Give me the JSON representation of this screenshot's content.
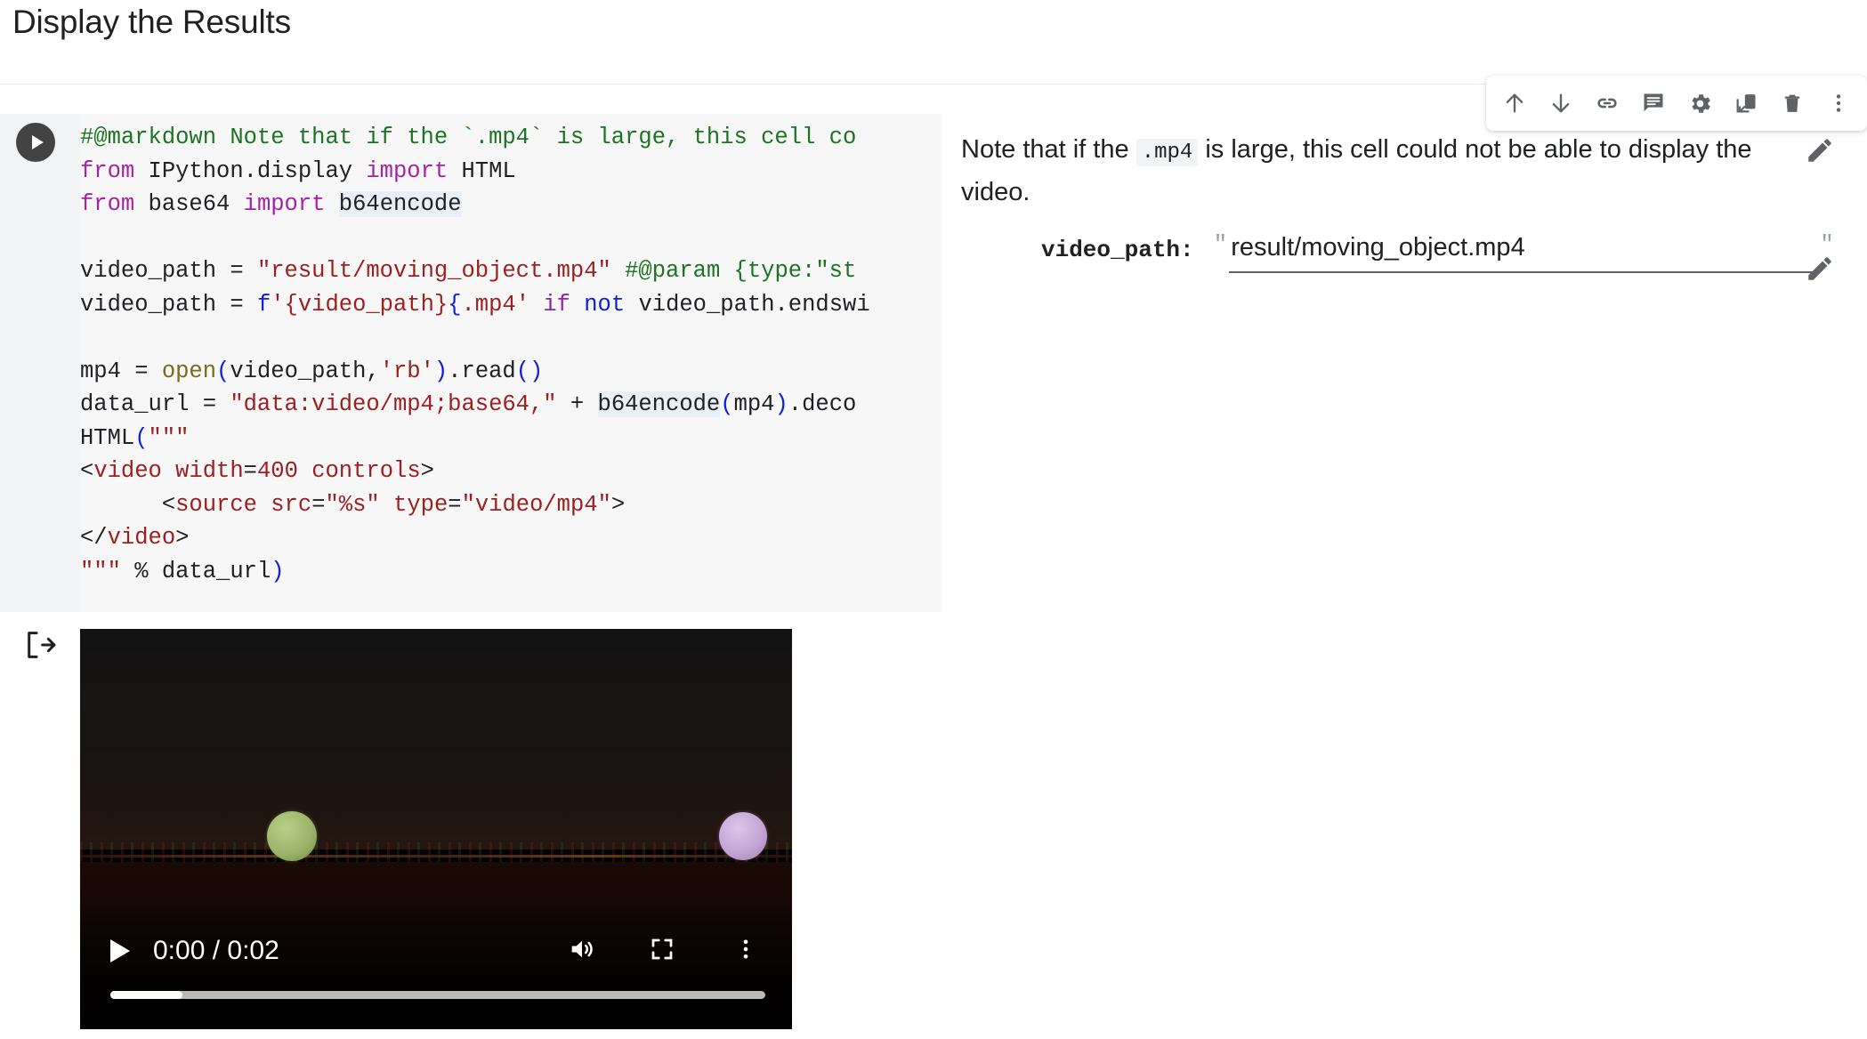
{
  "heading": "Display the Results",
  "toolbar": {
    "buttons": [
      {
        "name": "move-cell-up",
        "icon": "arrow-up-icon"
      },
      {
        "name": "move-cell-down",
        "icon": "arrow-down-icon"
      },
      {
        "name": "copy-link-to-cell",
        "icon": "link-icon"
      },
      {
        "name": "add-comment",
        "icon": "comment-icon"
      },
      {
        "name": "cell-settings",
        "icon": "gear-icon"
      },
      {
        "name": "mirror-cell-in-tab",
        "icon": "open-in-new-icon"
      },
      {
        "name": "delete-cell",
        "icon": "trash-icon"
      },
      {
        "name": "more-cell-actions",
        "icon": "more-vert-icon"
      }
    ]
  },
  "cell": {
    "run_button_label": "Run cell",
    "code_lines": [
      "#@markdown Note that if the `.mp4` is large, this cell co",
      "from IPython.display import HTML",
      "from base64 import b64encode",
      "",
      "video_path = \"result/moving_object.mp4\" #@param {type:\"st",
      "video_path = f'{video_path}.mp4' if not video_path.endswi",
      "",
      "mp4 = open(video_path,'rb').read()",
      "data_url = \"data:video/mp4;base64,\" + b64encode(mp4).deco",
      "HTML(\"\"\"",
      "<video width=400 controls>",
      "      <source src=\"%s\" type=\"video/mp4\">",
      "</video>",
      "\"\"\" % data_url)"
    ]
  },
  "form": {
    "note_part1": "Note that if the",
    "note_code": ".mp4",
    "note_part2": "is large, this cell could not be able to display the video.",
    "field_label": "video_path:",
    "field_value": "result/moving_object.mp4",
    "field_placeholder": "result/moving_object.mp4",
    "quote_open": "\"",
    "quote_close": "\"",
    "edit_note_icon": "pencil-icon",
    "edit_field_icon": "pencil-icon"
  },
  "output": {
    "icon": "output-arrow-icon",
    "video": {
      "play_label": "play",
      "time_display": "0:00 / 0:02",
      "current_time": "0:00",
      "duration": "0:02",
      "progress_percent": 11,
      "volume_icon": "volume-up-icon",
      "fullscreen_icon": "fullscreen-icon",
      "more_icon": "more-vert-icon"
    }
  },
  "colors": {
    "comment": "#1d7324",
    "keyword": "#a324a3",
    "string": "#9c2020",
    "builtin": "#7a6a1e",
    "paren": "#1020e0",
    "code_bg": "#f7f7f7",
    "gutter_bg": "#f1f3f4"
  }
}
